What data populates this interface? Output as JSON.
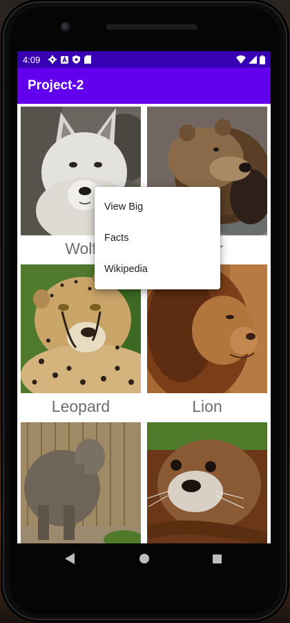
{
  "status_bar": {
    "time": "4:09",
    "left_icons": [
      "gear-icon",
      "a-icon",
      "shield-icon",
      "sd-card-icon"
    ],
    "right_icons": [
      "wifi-icon",
      "cell-signal-icon",
      "battery-icon"
    ]
  },
  "app_bar": {
    "title": "Project-2"
  },
  "grid": {
    "tiles": [
      {
        "label": "Wolf",
        "visible_label": "Wolf",
        "image": "wolf"
      },
      {
        "label": "Bear",
        "visible_label": "r",
        "image": "bear"
      },
      {
        "label": "Leopard",
        "image": "cheetah"
      },
      {
        "label": "Lion",
        "image": "lion"
      },
      {
        "label": "",
        "image": "elephant"
      },
      {
        "label": "",
        "image": "otter"
      }
    ]
  },
  "context_menu": {
    "items": [
      "View Big",
      "Facts",
      "Wikipedia"
    ]
  },
  "nav_bar": {
    "icons": [
      "back-icon",
      "home-icon",
      "recents-icon"
    ]
  },
  "colors": {
    "status_bar": "#3700b3",
    "app_bar": "#6200ee",
    "caption_text": "#6d6d6d"
  }
}
